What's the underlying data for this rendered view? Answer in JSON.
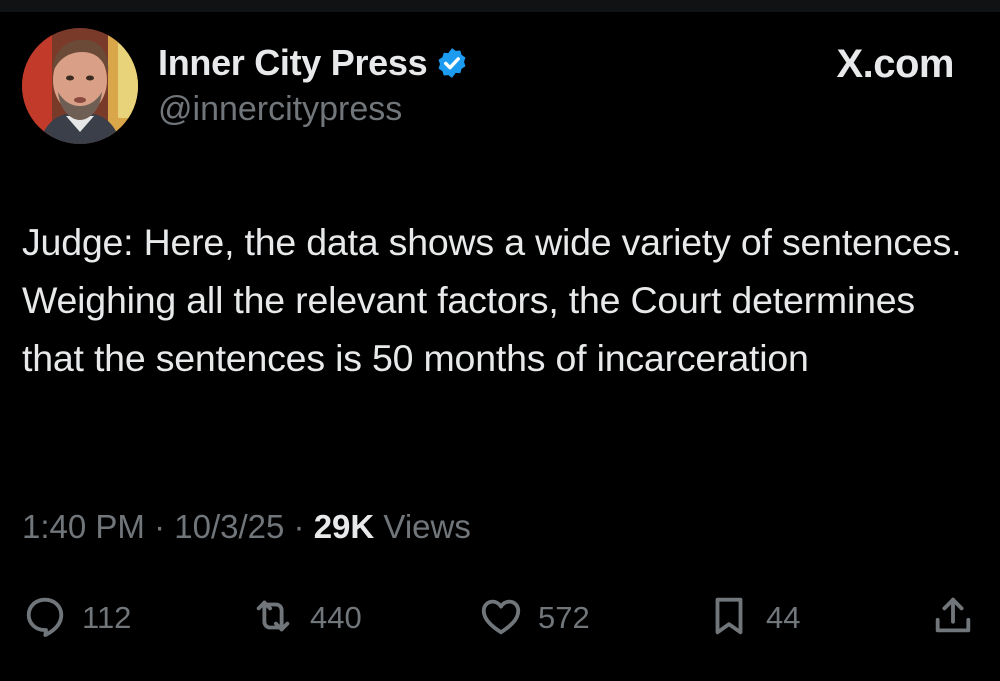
{
  "author": {
    "display_name": "Inner City Press",
    "handle": "@innercitypress",
    "verified": true
  },
  "site_label": "X.com",
  "tweet": {
    "text": "Judge: Here, the data shows a wide variety of sentences. Weighing all the relevant factors, the Court determines that the sentences is 50 months of incarceration"
  },
  "meta": {
    "time": "1:40 PM",
    "separator": "·",
    "date": "10/3/25",
    "views_count": "29K",
    "views_label": "Views"
  },
  "actions": {
    "replies": "112",
    "reposts": "440",
    "likes": "572",
    "bookmarks": "44"
  },
  "colors": {
    "background": "#000000",
    "text_primary": "#e7e9ea",
    "text_secondary": "#71767b",
    "verified_badge": "#1d9bf0"
  },
  "icons": {
    "verified": "verified-badge-icon",
    "reply": "reply-bubble-icon",
    "repost": "repost-arrows-icon",
    "like": "heart-icon",
    "bookmark": "bookmark-icon",
    "share": "share-upload-icon"
  }
}
